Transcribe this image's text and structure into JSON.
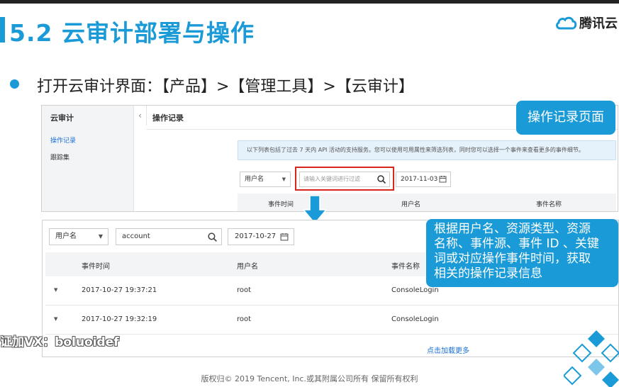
{
  "slide": {
    "title": "5.2 云审计部署与操作",
    "logo_text": "腾讯云",
    "bullet": "打开云审计界面：【产品】>【管理工具】>【云审计】",
    "footer": "版权归© 2019 Tencent, Inc.或其附属公司所有 保留所有权利",
    "watermark": "证加VX：boluoidef",
    "accent_color": "#1a9bd7"
  },
  "screenshot1": {
    "sidebar_title": "云审计",
    "sidebar_items": [
      "操作记录",
      "跟踪集"
    ],
    "collapse_icon": "chevron-left-icon",
    "collapse_glyph": "‹",
    "page_title": "操作记录",
    "info_text": "以下列表包括了过去 7 天内 API 活动的支持服务。您可以使用可用属性来筛选列表，同时您可以选择一个事件来查看更多的事件细节。",
    "filter_select": "用户名",
    "search_placeholder": "请输入关键词进行过滤",
    "date": "2017-11-03",
    "columns": [
      "事件时间",
      "用户名",
      "事件名称"
    ]
  },
  "screenshot2": {
    "filter_select": "用户名",
    "search_value": "account",
    "date": "2017-10-27",
    "columns": [
      "事件时间",
      "用户名",
      "事件名称"
    ],
    "rows": [
      {
        "time": "2017-10-27 19:37:21",
        "user": "root",
        "event": "ConsoleLogin"
      },
      {
        "time": "2017-10-27 19:32:19",
        "user": "root",
        "event": "ConsoleLogin"
      }
    ],
    "load_more": "点击加载更多"
  },
  "callouts": {
    "page_label": "操作记录页面",
    "description_lines": [
      "根据用户名、资源类型、资源",
      "名称、事件源、事件 ID 、关键",
      "词或对应操作事件时间，获取",
      "相关的操作记录信息"
    ]
  }
}
